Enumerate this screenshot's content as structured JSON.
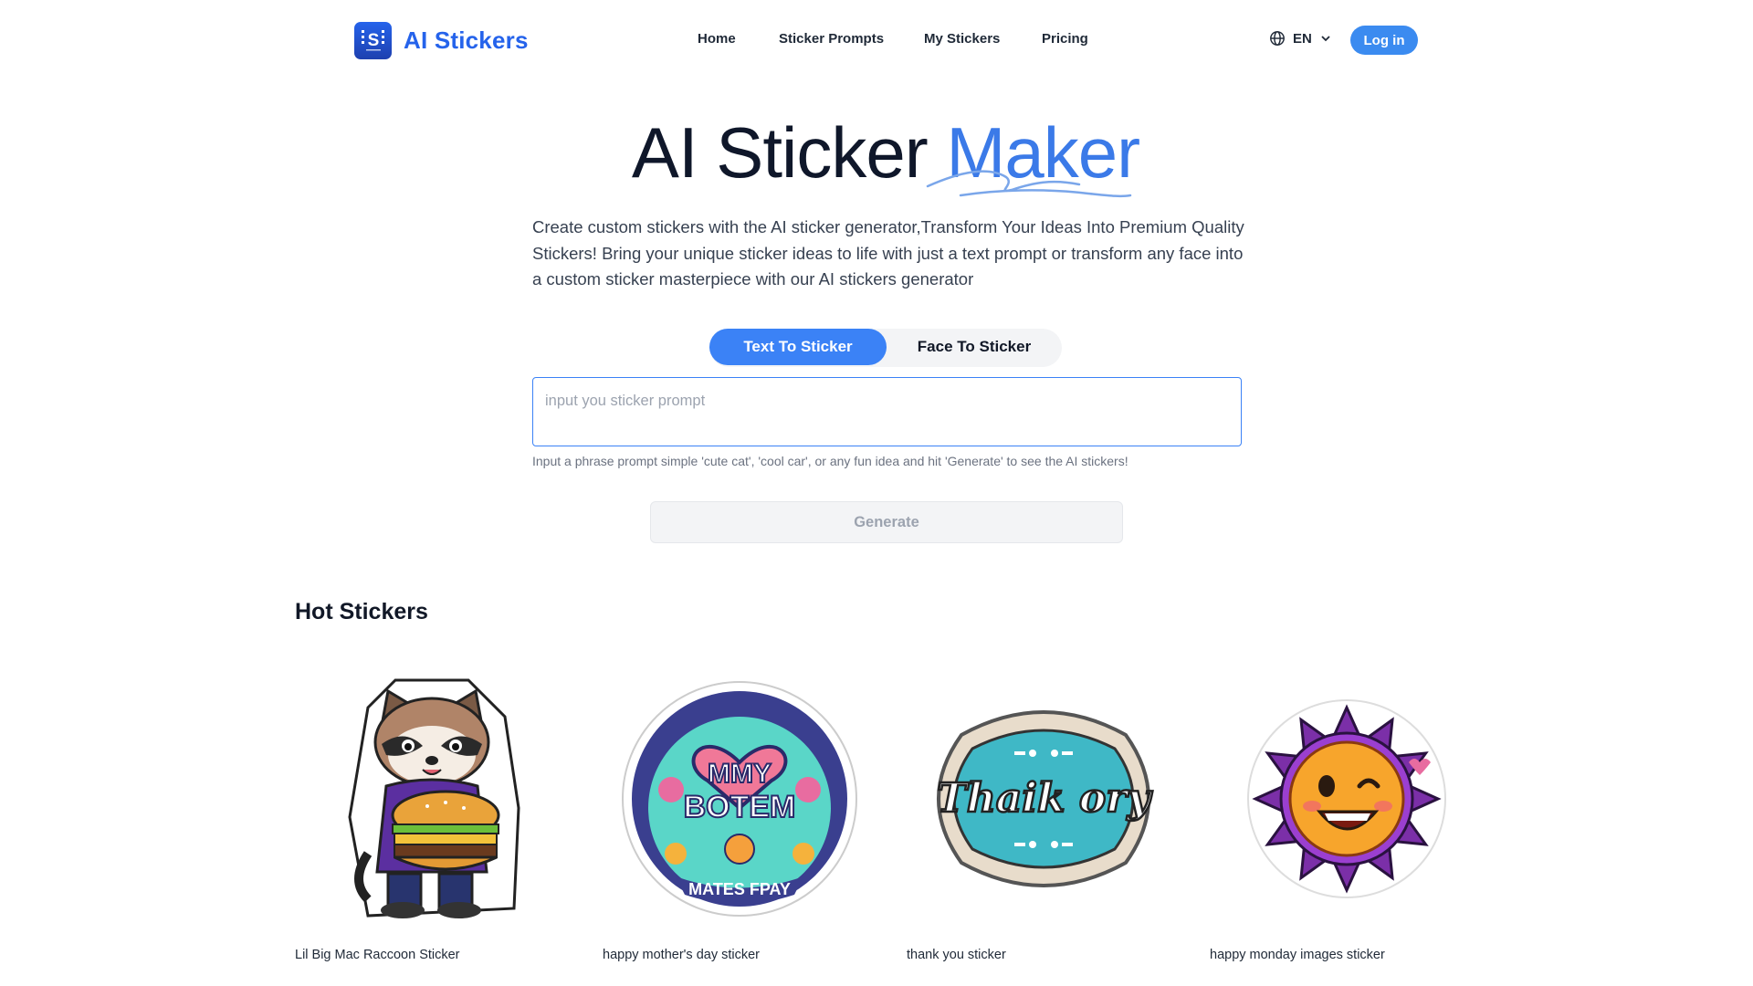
{
  "brand": {
    "name": "AI Stickers",
    "logo_glyph": "S"
  },
  "nav": {
    "items": [
      "Home",
      "Sticker Prompts",
      "My Stickers",
      "Pricing"
    ]
  },
  "language": {
    "code": "EN",
    "icon": "globe-icon"
  },
  "login_label": "Log in",
  "hero": {
    "title_main": "AI Sticker",
    "title_accent": "Maker",
    "description": "Create custom stickers with the AI sticker generator,Transform Your Ideas Into Premium Quality Stickers! Bring your unique sticker ideas to life with just a text prompt or transform any face into a custom sticker masterpiece with our AI stickers generator"
  },
  "tabs": [
    {
      "label": "Text To Sticker",
      "active": true
    },
    {
      "label": "Face To Sticker",
      "active": false
    }
  ],
  "prompt": {
    "placeholder": "input you sticker prompt",
    "value": "",
    "hint": "Input a phrase prompt simple 'cute cat', 'cool car', or any fun idea and hit 'Generate' to see the AI stickers!"
  },
  "generate_label": "Generate",
  "hot_stickers": {
    "title": "Hot Stickers",
    "items": [
      {
        "label": "Lil Big Mac Raccoon Sticker",
        "image": "raccoon-burger-sticker"
      },
      {
        "label": "happy mother's day sticker",
        "image": "mothers-day-heart-sticker",
        "image_text_top": "MMY",
        "image_text_mid": "BOTEM",
        "image_text_bottom": "MATES FPAY"
      },
      {
        "label": "thank you sticker",
        "image": "thank-you-sticker",
        "image_text": "Thaik ory"
      },
      {
        "label": "happy monday images sticker",
        "image": "sunflower-smiley-sticker"
      }
    ]
  },
  "colors": {
    "accent": "#3b82f6",
    "brand": "#2563eb",
    "title": "#0f172a"
  }
}
